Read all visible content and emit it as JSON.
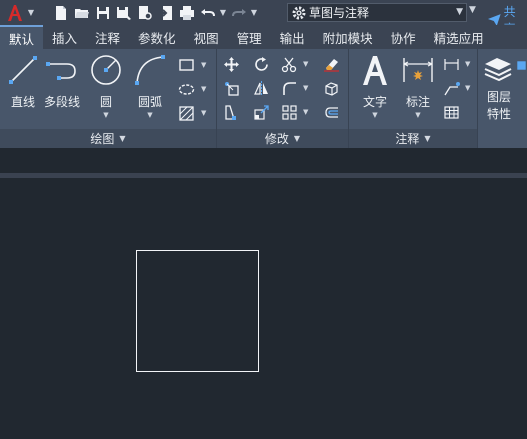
{
  "quick_access": {
    "app_icon": "autocad-a-icon",
    "buttons": [
      "new-icon",
      "open-icon",
      "save-icon",
      "save-as-icon",
      "plot-preview-icon",
      "export-icon",
      "print-icon",
      "undo-icon",
      "redo-icon"
    ]
  },
  "workspace": {
    "selected": "草图与注释",
    "share_label": "共享"
  },
  "tabs": [
    {
      "label": "默认",
      "active": true
    },
    {
      "label": "插入"
    },
    {
      "label": "注释"
    },
    {
      "label": "参数化"
    },
    {
      "label": "视图"
    },
    {
      "label": "管理"
    },
    {
      "label": "输出"
    },
    {
      "label": "附加模块"
    },
    {
      "label": "协作"
    },
    {
      "label": "精选应用"
    }
  ],
  "panels": {
    "draw": {
      "title": "绘图",
      "buttons": {
        "line": "直线",
        "polyline": "多段线",
        "circle": "圆",
        "arc": "圆弧"
      }
    },
    "modify": {
      "title": "修改"
    },
    "annotation": {
      "title": "注释",
      "buttons": {
        "text": "文字",
        "dimension": "标注"
      }
    },
    "layers": {
      "button": "图层特性"
    }
  },
  "colors": {
    "ribbon": "#48566a",
    "toolbar": "#3b4453",
    "canvas": "#212830",
    "accent": "#5aa7f2",
    "app_red": "#d52a2a"
  }
}
